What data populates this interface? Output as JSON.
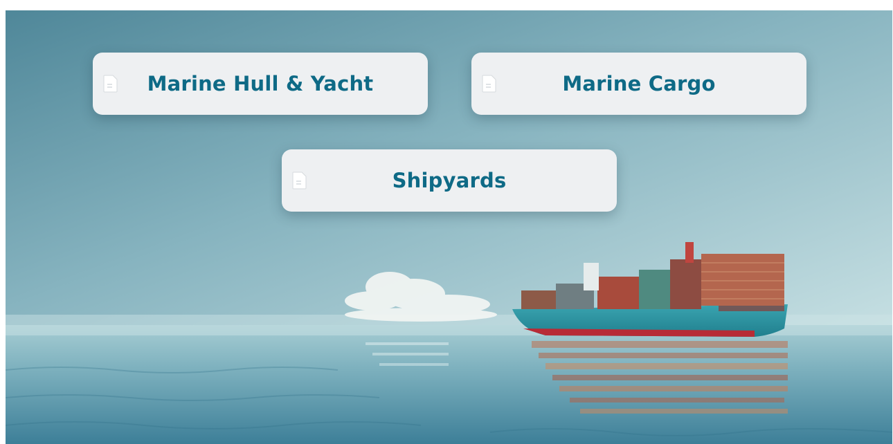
{
  "cards": [
    {
      "label": "Marine Hull & Yacht",
      "icon": "document-icon"
    },
    {
      "label": "Marine Cargo",
      "icon": "document-icon"
    },
    {
      "label": "Shipyards",
      "icon": "document-icon"
    }
  ],
  "colors": {
    "label": "#0e6a86",
    "card_bg": "#eef0f2",
    "sky": "#7aa9b6",
    "sea": "#4c8aa0"
  }
}
